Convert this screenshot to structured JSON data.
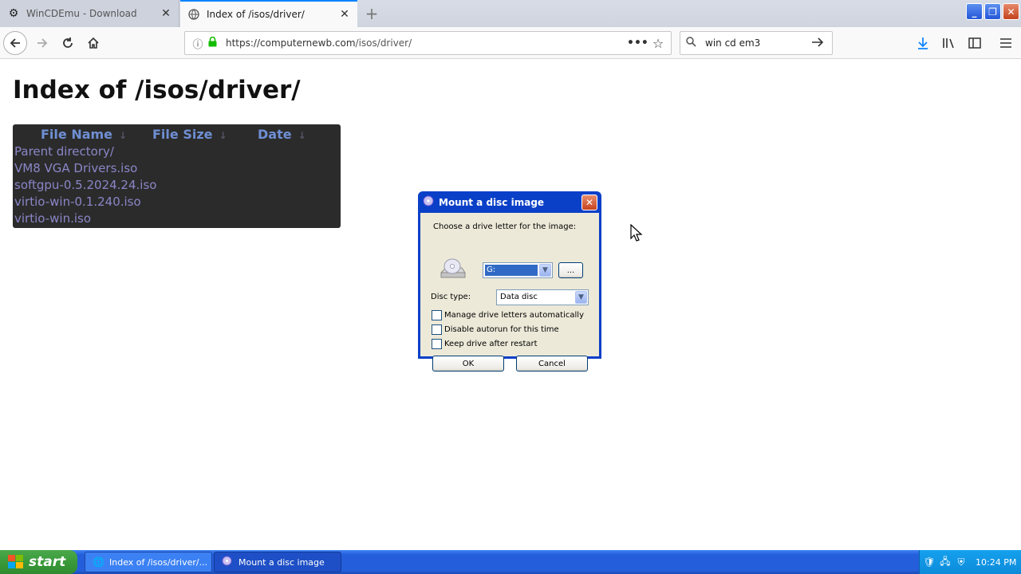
{
  "browser": {
    "tabs": [
      {
        "title": "WinCDEmu - Download",
        "icon": "gear-icon"
      },
      {
        "title": "Index of /isos/driver/",
        "icon": "globe-icon"
      }
    ],
    "url_domain": "https://computernewb.com",
    "url_path": "/isos/driver/",
    "search_text": "win cd em3"
  },
  "page": {
    "title": "Index of /isos/driver/",
    "columns": [
      "File Name",
      "File Size",
      "Date"
    ],
    "sort_arrow": "↓",
    "files": [
      {
        "name": "Parent directory/",
        "size": "",
        "date": ""
      },
      {
        "name": "VM8 VGA Drivers.iso",
        "size": "",
        "date": ""
      },
      {
        "name": "softgpu-0.5.2024.24.iso",
        "size": "",
        "date": ""
      },
      {
        "name": "virtio-win-0.1.240.iso",
        "size": "",
        "date": ""
      },
      {
        "name": "virtio-win.iso",
        "size": "",
        "date": ""
      }
    ]
  },
  "dialog": {
    "title": "Mount a disc image",
    "choose_label": "Choose a drive letter for the image:",
    "drive_value": "G:",
    "browse_label": "...",
    "disc_type_label": "Disc type:",
    "disc_type_value": "Data disc",
    "checkboxes": [
      {
        "label": "Manage drive letters automatically",
        "checked": false
      },
      {
        "label": "Disable autorun for this time",
        "checked": false
      },
      {
        "label": "Keep drive after restart",
        "checked": false
      }
    ],
    "ok_label": "OK",
    "cancel_label": "Cancel"
  },
  "taskbar": {
    "start_label": "start",
    "tasks": [
      {
        "label": "Index of /isos/driver/...",
        "active": true
      },
      {
        "label": "Mount a disc image",
        "active": false
      }
    ],
    "clock": "10:24 PM"
  },
  "colors": {
    "firefox_accent": "#0a84ff",
    "xp_titlebar": "#0a3fc8",
    "listing_bg": "#2b2b2b",
    "listing_link": "#8a86c7",
    "listing_header": "#6f8fd4"
  }
}
